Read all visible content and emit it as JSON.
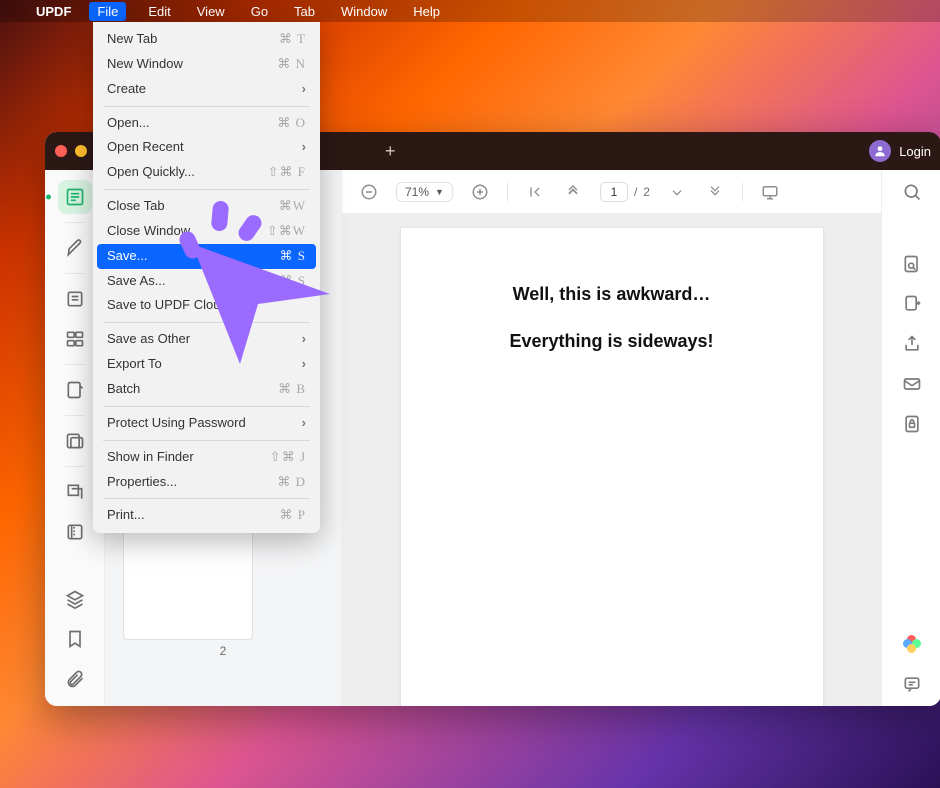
{
  "menubar": {
    "app_name": "UPDF",
    "items": [
      "File",
      "Edit",
      "View",
      "Go",
      "Tab",
      "Window",
      "Help"
    ],
    "active_index": 0
  },
  "file_menu": {
    "groups": [
      [
        {
          "label": "New Tab",
          "shortcut": "⌘ T"
        },
        {
          "label": "New Window",
          "shortcut": "⌘ N"
        },
        {
          "label": "Create",
          "submenu": true
        }
      ],
      [
        {
          "label": "Open...",
          "shortcut": "⌘ O"
        },
        {
          "label": "Open Recent",
          "submenu": true
        },
        {
          "label": "Open Quickly...",
          "shortcut": "⇧⌘ F"
        }
      ],
      [
        {
          "label": "Close Tab",
          "shortcut": "⌘W"
        },
        {
          "label": "Close Window",
          "shortcut": "⇧⌘W"
        },
        {
          "label": "Save...",
          "shortcut": "⌘ S",
          "selected": true
        },
        {
          "label": "Save As...",
          "shortcut": "⇧⌘ S"
        },
        {
          "label": "Save to UPDF Cloud"
        }
      ],
      [
        {
          "label": "Save as Other",
          "submenu": true
        },
        {
          "label": "Export To",
          "submenu": true
        },
        {
          "label": "Batch",
          "shortcut": "⌘ B"
        }
      ],
      [
        {
          "label": "Protect Using Password",
          "submenu": true
        }
      ],
      [
        {
          "label": "Show in Finder",
          "shortcut": "⇧⌘ J"
        },
        {
          "label": "Properties...",
          "shortcut": "⌘ D"
        }
      ],
      [
        {
          "label": "Print...",
          "shortcut": "⌘ P"
        }
      ]
    ]
  },
  "window": {
    "login_label": "Login",
    "toolbar": {
      "zoom_level": "71%",
      "page_current": "1",
      "page_separator": "/",
      "page_total": "2"
    },
    "thumbnails": {
      "page_2_label": "2"
    },
    "document": {
      "line1": "Well, this is awkward…",
      "line2": "Everything is sideways!"
    }
  }
}
